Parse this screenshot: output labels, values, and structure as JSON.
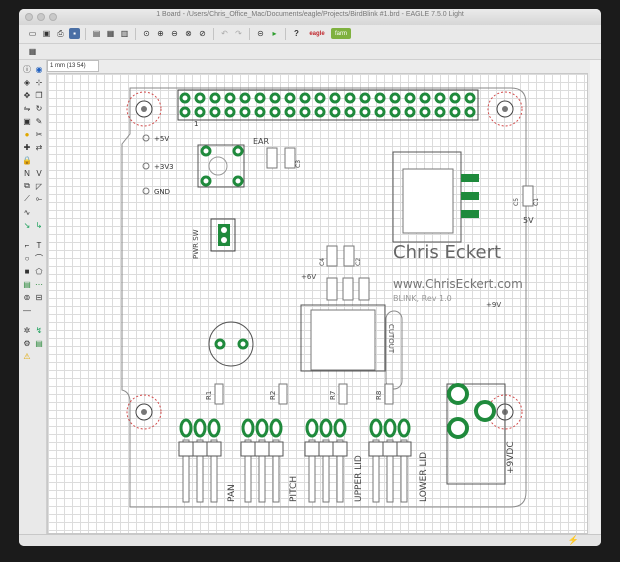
{
  "window": {
    "title": "1 Board - /Users/Chris_Office_Mac/Documents/eagle/Projects/BirdBlink #1.brd - EAGLE 7.5.0 Light"
  },
  "toolbar": {
    "help_label": "?",
    "eagle_label": "eagle",
    "farm_label": "farm"
  },
  "coord_display": "1 mm (13 54)",
  "board": {
    "author": "Chris Eckert",
    "website": "www.ChrisEckert.com",
    "revision": "BLINK, Rev 1.0",
    "power_labels": {
      "v5": "+5V",
      "v3v3": "+3V3",
      "gnd": "GND"
    },
    "pin1_label": "1",
    "ear_label": "EAR",
    "pwr_sw_label": "PWR SW",
    "v5_right_label": "5V",
    "plus6v_label": "+6V",
    "plus9v_label": "+9V",
    "cutout_label": "CUTOUT",
    "servo_labels": [
      "PAN",
      "PITCH",
      "UPPER LID",
      "LOWER LID"
    ],
    "dc_label": "+9VDC",
    "resistor_labels": [
      "R1",
      "R2",
      "R7",
      "R8"
    ],
    "cap_labels": [
      "C3",
      "C4",
      "C2",
      "C5",
      "C1"
    ]
  },
  "status_icon": "lightning-icon"
}
